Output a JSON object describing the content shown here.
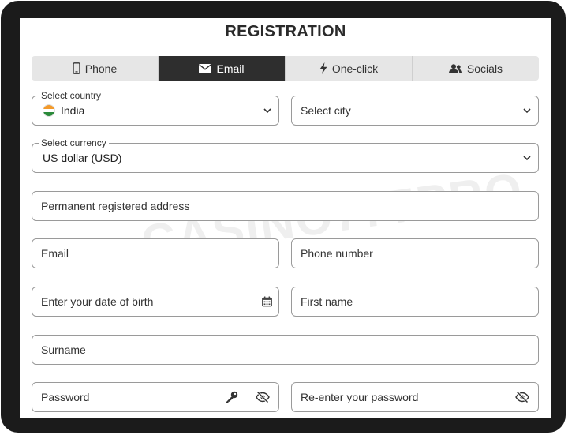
{
  "form": {
    "title": "REGISTRATION"
  },
  "watermark": "CASINO777PRO",
  "tabs": [
    {
      "label": "Phone",
      "icon": "phone-icon"
    },
    {
      "label": "Email",
      "icon": "envelope-icon",
      "active": true
    },
    {
      "label": "One-click",
      "icon": "lightning-icon"
    },
    {
      "label": "Socials",
      "icon": "users-icon"
    }
  ],
  "country": {
    "legend": "Select country",
    "value": "India",
    "icon": "india-flag-icon"
  },
  "city": {
    "placeholder": "Select city"
  },
  "currency": {
    "legend": "Select currency",
    "value": "US dollar (USD)"
  },
  "address": {
    "placeholder": "Permanent registered address"
  },
  "email": {
    "placeholder": "Email"
  },
  "phone": {
    "placeholder": "Phone number"
  },
  "dob": {
    "placeholder": "Enter your date of birth",
    "icon": "calendar-icon"
  },
  "first_name": {
    "placeholder": "First name"
  },
  "surname": {
    "placeholder": "Surname"
  },
  "password": {
    "placeholder": "Password",
    "icons": [
      "key-icon",
      "eye-slash-icon"
    ]
  },
  "repassword": {
    "placeholder": "Re-enter your password",
    "icon": "eye-slash-icon"
  },
  "colors": {
    "active_tab": "#2e2e2e",
    "tab_bg": "#e6e6e6",
    "border": "#9a9a9a",
    "frame": "#1b1b1b"
  }
}
